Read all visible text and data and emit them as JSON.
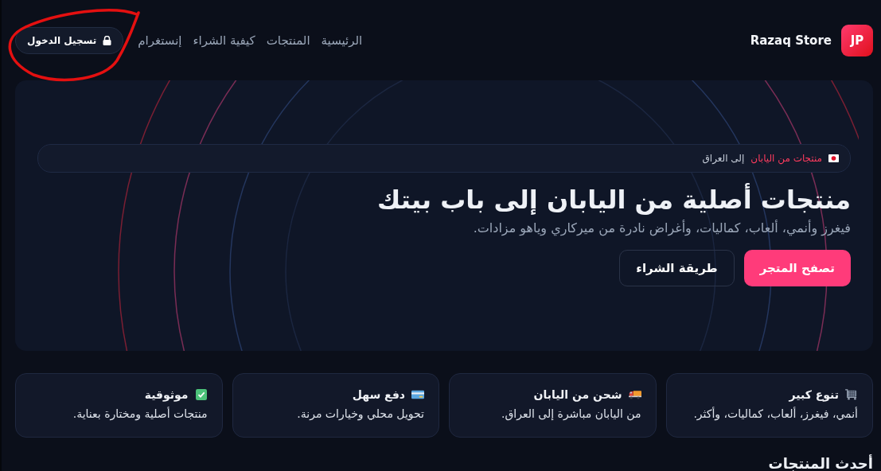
{
  "header": {
    "logo_badge": "JP",
    "brand": "Razaq Store",
    "nav": [
      "الرئيسية",
      "المنتجات",
      "كيفية الشراء",
      "إنستغرام"
    ],
    "login_button": "تسجيل الدخول"
  },
  "hero": {
    "tagline": {
      "highlight": "منتجات من اليابان",
      "rest": "إلى العراق"
    },
    "title": "منتجات أصلية من اليابان إلى باب بيتك",
    "subtitle": "فيغرز وأنمي، ألعاب، كماليات، وأغراض نادرة من ميركاري وياهو مزادات.",
    "buttons": [
      {
        "label": "تصفح المتجر",
        "kind": "primary"
      },
      {
        "label": "طريقة الشراء",
        "kind": "secondary"
      }
    ]
  },
  "features": [
    {
      "kind": "cart",
      "title": "تنوع كبير",
      "text": "أنمي، فيغرز، ألعاب، كماليات، وأكثر."
    },
    {
      "kind": "truck",
      "title": "شحن من اليابان",
      "text": "من اليابان مباشرة إلى العراق."
    },
    {
      "kind": "card",
      "title": "دفع سهل",
      "text": "تحويل محلي وخيارات مرنة."
    },
    {
      "kind": "check",
      "title": "موثوقية",
      "text": "منتجات أصلية ومختارة بعناية."
    }
  ],
  "section_title": "أحدث المنتجات"
}
